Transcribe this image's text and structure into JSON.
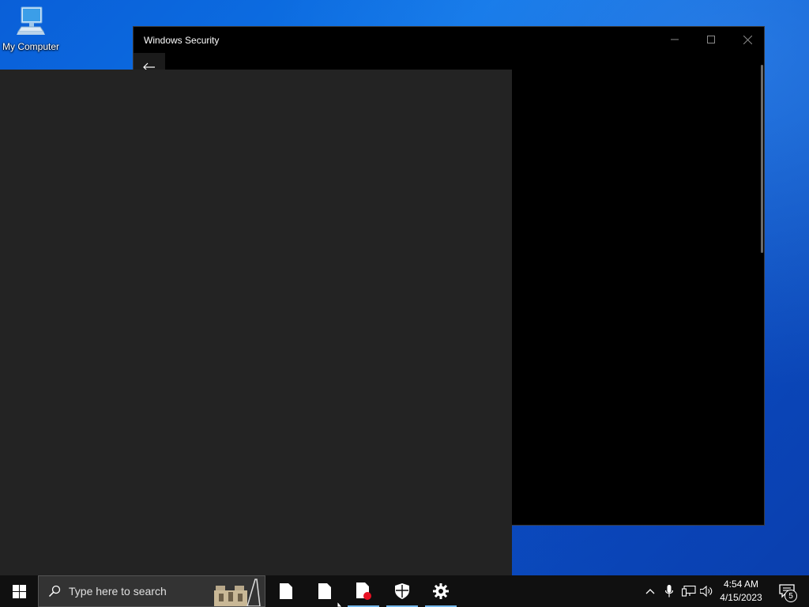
{
  "desktop": {
    "icons": [
      {
        "label": "My Computer",
        "icon": "computer-icon"
      }
    ]
  },
  "window": {
    "title": "Windows Security",
    "controls": [
      "minimize-icon",
      "maximize-icon",
      "close-icon"
    ],
    "back_icon": "back-arrow-icon"
  },
  "taskbar": {
    "start_icon": "windows-logo-icon",
    "search": {
      "placeholder": "Type here to search",
      "icon": "search-icon"
    },
    "apps": [
      {
        "name": "file-icon"
      },
      {
        "name": "file-icon"
      },
      {
        "name": "file-recording-icon"
      },
      {
        "name": "shield-icon"
      },
      {
        "name": "gear-icon"
      }
    ],
    "tray": {
      "icons": [
        "chevron-up-icon",
        "microphone-icon",
        "network-icon",
        "volume-icon"
      ],
      "time": "4:54 AM",
      "date": "4/15/2023",
      "notification_count": "5"
    }
  },
  "colors": {
    "desktop_blue": "#0d74e6",
    "window_bg": "#000000",
    "overlay_bg": "#232323",
    "taskbar_bg": "#101010",
    "accent_underline": "#76b9ed"
  }
}
